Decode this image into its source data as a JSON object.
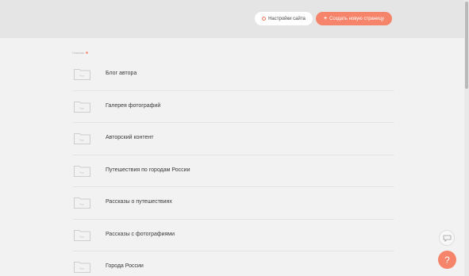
{
  "header": {
    "settings_label": "Настройки сайта",
    "create_label": "Создать новую страницу",
    "create_symbol": "+",
    "accent_color": "#f5846a"
  },
  "breadcrumb": {
    "text": "Главная"
  },
  "folder_icon_text": "Page",
  "pages": [
    {
      "label": "Блог автора"
    },
    {
      "label": "Галерея фотографий"
    },
    {
      "label": "Авторский контент"
    },
    {
      "label": "Путешествия по городам России"
    },
    {
      "label": "Рассказы о путешествиях"
    },
    {
      "label": "Рассказы с фотографиями"
    },
    {
      "label": "Города России"
    }
  ],
  "help": {
    "symbol": "?"
  }
}
